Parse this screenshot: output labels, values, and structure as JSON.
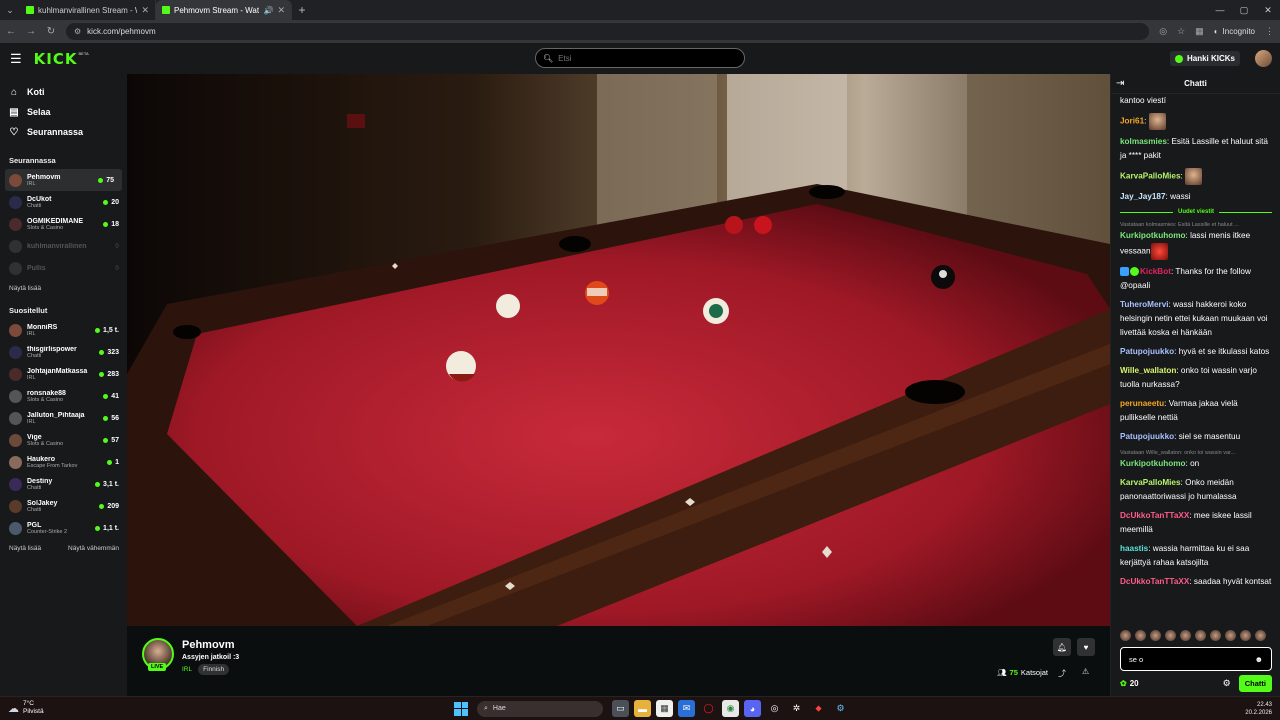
{
  "browser": {
    "tabs": [
      {
        "title": "kuhlmanvirallinen Stream - Wat",
        "active": false
      },
      {
        "title": "Pehmovm Stream - Watch I",
        "active": true
      }
    ],
    "url": "kick.com/pehmovm",
    "incognito_label": "Incognito"
  },
  "header": {
    "logo": "KICK",
    "beta": "BETA",
    "search_placeholder": "Etsi",
    "get_kicks": "Hanki KICKs"
  },
  "sidebar": {
    "nav": [
      {
        "label": "Koti",
        "icon": "home-icon"
      },
      {
        "label": "Selaa",
        "icon": "browse-icon"
      },
      {
        "label": "Seurannassa",
        "icon": "heart-icon"
      }
    ],
    "following_title": "Seurannassa",
    "following": [
      {
        "name": "Pehmovm",
        "category": "IRL",
        "viewers": "75",
        "online": true,
        "selected": true
      },
      {
        "name": "DcUkot",
        "category": "Chatti",
        "viewers": "20",
        "online": true
      },
      {
        "name": "OGMIKEDIMANE",
        "category": "Slots & Casino",
        "viewers": "18",
        "online": true
      },
      {
        "name": "kuhlmanvirallinen",
        "category": "",
        "viewers": "",
        "online": false
      },
      {
        "name": "Pullis",
        "category": "",
        "viewers": "",
        "online": false
      }
    ],
    "show_more": "Näytä lisää",
    "recommended_title": "Suositellut",
    "recommended": [
      {
        "name": "MonniRS",
        "category": "IRL",
        "viewers": "1,5 t."
      },
      {
        "name": "thisgirlispower",
        "category": "Chatti",
        "viewers": "323"
      },
      {
        "name": "JohtajanMatkassa",
        "category": "IRL",
        "viewers": "283"
      },
      {
        "name": "ronsnake88",
        "category": "Slots & Casino",
        "viewers": "41"
      },
      {
        "name": "Jalluton_Pihtaaja",
        "category": "IRL",
        "viewers": "56"
      },
      {
        "name": "Vige",
        "category": "Slots & Casino",
        "viewers": "57"
      },
      {
        "name": "Haukero",
        "category": "Escape From Tarkov",
        "viewers": "1"
      },
      {
        "name": "Destiny",
        "category": "Chatti",
        "viewers": "3,1 t."
      },
      {
        "name": "SolJakey",
        "category": "Chatti",
        "viewers": "209"
      },
      {
        "name": "PGL",
        "category": "Counter-Strike 2",
        "viewers": "1,1 t."
      }
    ],
    "show_more_2": "Näytä lisää",
    "show_less": "Näytä vähemmän"
  },
  "stream": {
    "name": "Pehmovm",
    "title": "Assyjen jatkoil :3",
    "category": "IRL",
    "tag": "Finnish",
    "live": "LIVE",
    "viewers": "75",
    "viewers_label": "Katsojat"
  },
  "chat": {
    "title": "Chatti",
    "messages": [
      {
        "user": "",
        "text": "kantoo viestí",
        "color": "#ffffff"
      },
      {
        "user": "Jori61",
        "text": "",
        "color": "#f5a623",
        "emote": true
      },
      {
        "user": "kolmasmies",
        "text": "Esitä Lassille et haluut sitä ja **** pakit",
        "color": "#7ae57a"
      },
      {
        "user": "KarvaPalloMies",
        "text": "",
        "color": "#b6f26c",
        "emote": true
      },
      {
        "user": "Jay_Jay187",
        "text": "wassi",
        "color": "#c8e6ff"
      }
    ],
    "new_messages": "Uudet viestit",
    "messages2": [
      {
        "reply": "Vastataan kolmasmies: Esitä Lassille et haluut ...",
        "user": "Kurkipotkuhomo",
        "text": "lassi menis itkee vessaan",
        "color": "#7ae57a",
        "emote": true
      },
      {
        "user": "KickBot",
        "text": "Thanks for the follow @opaali",
        "color": "#e0245e",
        "bot": true
      },
      {
        "user": "TuheroMervi",
        "text": "wassi hakkeroi koko helsingin netin ettei kukaan muukaan voi livettää koska ei hänkään",
        "color": "#a8c0ff"
      },
      {
        "user": "Patupojuukko",
        "text": "hyvä et se itkulassi katos",
        "color": "#a8c0ff"
      },
      {
        "user": "Wille_wallaton",
        "text": "onko toi wassin varjo tuolla nurkassa?",
        "color": "#d9f56b"
      },
      {
        "user": "perunaeetu",
        "text": "Varmaa jakaa vielä pullikselle nettiä",
        "color": "#f5a623"
      },
      {
        "user": "Patupojuukko",
        "text": "siel se masentuu",
        "color": "#a8c0ff"
      },
      {
        "reply": "Vastataan Wille_wallaton: onko toi wassin var...",
        "user": "Kurkipotkuhomo",
        "text": "on",
        "color": "#7ae57a"
      },
      {
        "user": "KarvaPalloMies",
        "text": "Onko meidän panonaattoriwassi jo humalassa",
        "color": "#b6f26c"
      },
      {
        "user": "DcUkkoTanTTaXX",
        "text": "mee iskee lassil meemillä",
        "color": "#ff5c8a"
      },
      {
        "user": "haastis",
        "text": "wassia harmittaa ku ei saa kerjättyä rahaa katsojilta",
        "color": "#5ce0d8"
      },
      {
        "user": "DcUkkoTanTTaXX",
        "text": "saadaa hyvät kontsat",
        "color": "#ff5c8a"
      }
    ],
    "input_value": "se o",
    "points": "20",
    "send_label": "Chatti"
  },
  "taskbar": {
    "temp": "7°C",
    "weather": "Pilvistä",
    "search": "Hae",
    "time": "22.43",
    "date": "20.2.2026"
  }
}
